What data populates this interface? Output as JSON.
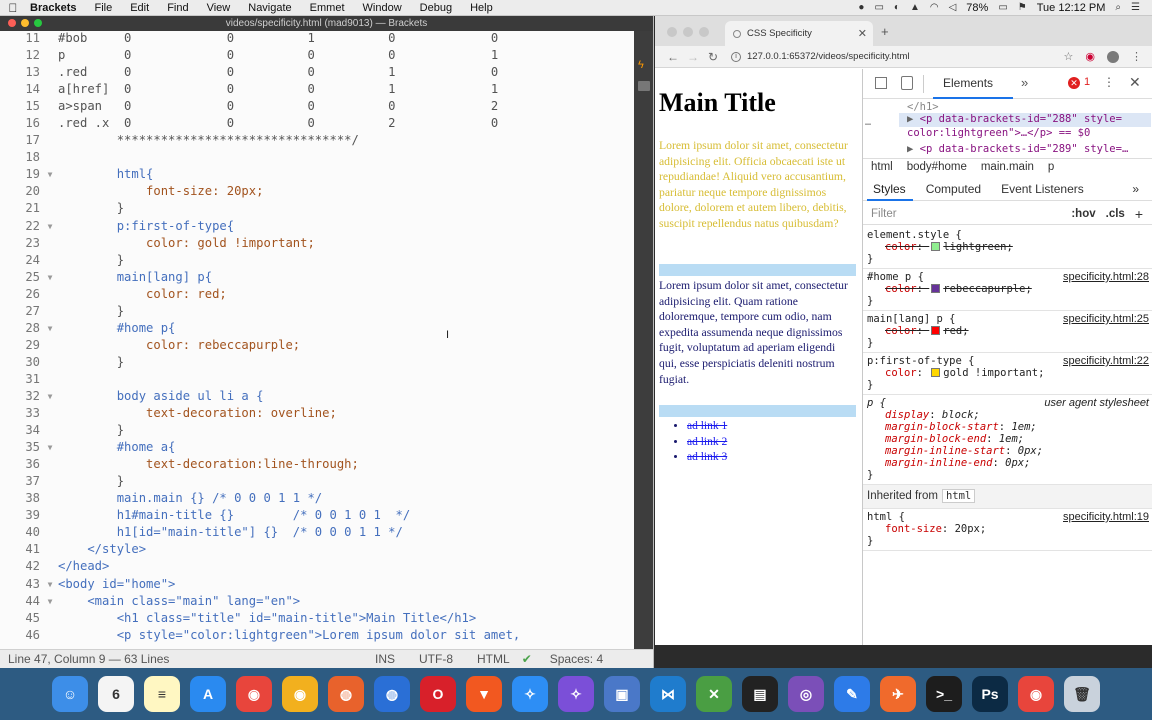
{
  "menubar": {
    "app": "Brackets",
    "items": [
      "File",
      "Edit",
      "Find",
      "View",
      "Navigate",
      "Emmet",
      "Window",
      "Debug",
      "Help"
    ],
    "battery": "78%",
    "clock": "Tue 12:12 PM"
  },
  "editor": {
    "title": "videos/specificity.html (mad9013) — Brackets",
    "lines": [
      {
        "n": "11",
        "text": "#bob     0             0          1          0             0",
        "cls": ""
      },
      {
        "n": "12",
        "text": "p        0             0          0          0             1",
        "cls": ""
      },
      {
        "n": "13",
        "text": ".red     0             0          0          1             0",
        "cls": ""
      },
      {
        "n": "14",
        "text": "a[href]  0             0          0          1             1",
        "cls": ""
      },
      {
        "n": "15",
        "text": "a>span   0             0          0          0             2",
        "cls": ""
      },
      {
        "n": "16",
        "text": ".red .x  0             0          0          2             0",
        "cls": ""
      },
      {
        "n": "17",
        "text": "        ********************************/",
        "cls": ""
      },
      {
        "n": "18",
        "text": "",
        "cls": ""
      },
      {
        "n": "19",
        "text": "        html{",
        "cls": "tag",
        "fold": "▼"
      },
      {
        "n": "20",
        "text": "            font-size: 20px;",
        "cls": "prop"
      },
      {
        "n": "21",
        "text": "        }",
        "cls": ""
      },
      {
        "n": "22",
        "text": "        p:first-of-type{",
        "cls": "tag",
        "fold": "▼"
      },
      {
        "n": "23",
        "text": "            color: gold !important;",
        "cls": "prop"
      },
      {
        "n": "24",
        "text": "        }",
        "cls": ""
      },
      {
        "n": "25",
        "text": "        main[lang] p{",
        "cls": "tag",
        "fold": "▼"
      },
      {
        "n": "26",
        "text": "            color: red;",
        "cls": "prop"
      },
      {
        "n": "27",
        "text": "        }",
        "cls": ""
      },
      {
        "n": "28",
        "text": "        #home p{",
        "cls": "tag",
        "fold": "▼"
      },
      {
        "n": "29",
        "text": "            color: rebeccapurple;",
        "cls": "prop"
      },
      {
        "n": "30",
        "text": "        }",
        "cls": ""
      },
      {
        "n": "31",
        "text": "",
        "cls": ""
      },
      {
        "n": "32",
        "text": "        body aside ul li a {",
        "cls": "tag",
        "fold": "▼"
      },
      {
        "n": "33",
        "text": "            text-decoration: overline;",
        "cls": "prop"
      },
      {
        "n": "34",
        "text": "        }",
        "cls": ""
      },
      {
        "n": "35",
        "text": "        #home a{",
        "cls": "tag",
        "fold": "▼"
      },
      {
        "n": "36",
        "text": "            text-decoration:line-through;",
        "cls": "prop"
      },
      {
        "n": "37",
        "text": "        }",
        "cls": ""
      },
      {
        "n": "38",
        "text": "        main.main {} /* 0 0 0 1 1 */",
        "cls": "tag"
      },
      {
        "n": "39",
        "text": "        h1#main-title {}        /* 0 0 1 0 1  */",
        "cls": "tag"
      },
      {
        "n": "40",
        "text": "        h1[id=\"main-title\"] {}  /* 0 0 0 1 1 */",
        "cls": "tag"
      },
      {
        "n": "41",
        "text": "    </style>",
        "cls": "tag"
      },
      {
        "n": "42",
        "text": "</head>",
        "cls": "tag"
      },
      {
        "n": "43",
        "text": "<body id=\"home\">",
        "cls": "tag",
        "fold": "▼"
      },
      {
        "n": "44",
        "text": "    <main class=\"main\" lang=\"en\">",
        "cls": "tag",
        "fold": "▼"
      },
      {
        "n": "45",
        "text": "        <h1 class=\"title\" id=\"main-title\">Main Title</h1>",
        "cls": "tag"
      },
      {
        "n": "46",
        "text": "        <p style=\"color:lightgreen\">Lorem ipsum dolor sit amet,",
        "cls": "tag"
      }
    ],
    "status": {
      "cursor": "Line 47, Column 9 — 63 Lines",
      "mode": "INS",
      "encoding": "UTF-8",
      "language": "HTML",
      "spaces": "Spaces: 4"
    }
  },
  "chrome": {
    "tab_title": "CSS Specificity",
    "url": "127.0.0.1:65372/videos/specificity.html",
    "page": {
      "title": "Main Title",
      "para1": "Lorem ipsum dolor sit amet, consectetur adipisicing elit. Officia obcaecati iste ut repudiandae! Aliquid vero accusantium, pariatur neque tempore dignissimos dolore, dolorem et autem libero, debitis, suscipit repellendus natus quibusdam?",
      "para2": "Lorem ipsum dolor sit amet, consectetur adipisicing elit. Quam ratione doloremque, tempore cum odio, nam expedita assumenda neque dignissimos fugit, voluptatum ad aperiam eligendi qui, esse perspiciatis deleniti nostrum fugiat.",
      "links": [
        "ad link 1",
        "ad link 2",
        "ad link 3"
      ]
    },
    "devtools": {
      "elements_tab": "Elements",
      "error_count": "1",
      "dom": {
        "row1": "</h1>",
        "row2": "<p data-brackets-id=\"288\" style=",
        "row3": "color:lightgreen\">…</p> == $0",
        "row4": "<p data-brackets-id=\"289\" style=…"
      },
      "breadcrumb": [
        "html",
        "body#home",
        "main.main",
        "p"
      ],
      "style_tabs": [
        "Styles",
        "Computed",
        "Event Listeners"
      ],
      "filter_placeholder": "Filter",
      "hov": ":hov",
      "cls": ".cls",
      "rules": [
        {
          "selector": "element.style {",
          "source": "",
          "decls": [
            {
              "name": "color",
              "value": "lightgreen;",
              "swatch": "#90ee90",
              "struck": true
            }
          ]
        },
        {
          "selector": "#home p {",
          "source": "specificity.html:28",
          "decls": [
            {
              "name": "color",
              "value": "rebeccapurple;",
              "swatch": "#663399",
              "struck": true
            }
          ]
        },
        {
          "selector": "main[lang] p {",
          "source": "specificity.html:25",
          "decls": [
            {
              "name": "color",
              "value": "red;",
              "swatch": "#ff0000",
              "struck": true
            }
          ]
        },
        {
          "selector": "p:first-of-type {",
          "source": "specificity.html:22",
          "decls": [
            {
              "name": "color",
              "value": "gold !important;",
              "swatch": "#ffd700",
              "struck": false
            }
          ]
        },
        {
          "selector": "p {",
          "source": "user agent stylesheet",
          "ua": true,
          "decls": [
            {
              "name": "display",
              "value": "block;"
            },
            {
              "name": "margin-block-start",
              "value": "1em;"
            },
            {
              "name": "margin-block-end",
              "value": "1em;"
            },
            {
              "name": "margin-inline-start",
              "value": "0px;"
            },
            {
              "name": "margin-inline-end",
              "value": "0px;"
            }
          ]
        }
      ],
      "inherited_label": "Inherited from",
      "inherited_tag": "html",
      "inherited_rule": {
        "selector": "html {",
        "source": "specificity.html:19",
        "decl_name": "font-size",
        "decl_value": "20px;"
      }
    }
  },
  "dock": {
    "icons": [
      {
        "name": "finder-icon",
        "color": "#3d8ee8",
        "glyph": "☺"
      },
      {
        "name": "calendar-icon",
        "color": "#f4f4f4",
        "glyph": "6"
      },
      {
        "name": "notes-icon",
        "color": "#fff7c2",
        "glyph": "≡"
      },
      {
        "name": "app-store-icon",
        "color": "#2a8af0",
        "glyph": "A"
      },
      {
        "name": "chrome-icon",
        "color": "#e8453c",
        "glyph": "◉"
      },
      {
        "name": "chrome-canary-icon",
        "color": "#f2b01e",
        "glyph": "◉"
      },
      {
        "name": "firefox-icon",
        "color": "#e8622c",
        "glyph": "◍"
      },
      {
        "name": "firefox-dev-icon",
        "color": "#2a6fd6",
        "glyph": "◍"
      },
      {
        "name": "opera-icon",
        "color": "#d8202a",
        "glyph": "O"
      },
      {
        "name": "brave-icon",
        "color": "#f25820",
        "glyph": "▼"
      },
      {
        "name": "safari-icon",
        "color": "#2d8ef5",
        "glyph": "✧"
      },
      {
        "name": "safari-tp-icon",
        "color": "#7b4fd8",
        "glyph": "✧"
      },
      {
        "name": "photo-booth-icon",
        "color": "#4a78c8",
        "glyph": "▣"
      },
      {
        "name": "visual-studio-icon",
        "color": "#1f7ccd",
        "glyph": "⋈"
      },
      {
        "name": "xcode-icon",
        "color": "#4a9e43",
        "glyph": "✕"
      },
      {
        "name": "tableplus-icon",
        "color": "#222222",
        "glyph": "▤"
      },
      {
        "name": "github-desktop-icon",
        "color": "#7b4fb8",
        "glyph": "◎"
      },
      {
        "name": "xd-icon",
        "color": "#2d7be8",
        "glyph": "✎"
      },
      {
        "name": "postman-icon",
        "color": "#f06a2c",
        "glyph": "✈"
      },
      {
        "name": "terminal-icon",
        "color": "#1d1d1d",
        "glyph": ">_"
      },
      {
        "name": "photoshop-icon",
        "color": "#0c2a44",
        "glyph": "Ps"
      },
      {
        "name": "chrome-2-icon",
        "color": "#e8453c",
        "glyph": "◉"
      },
      {
        "name": "trash-icon",
        "color": "#c9d2dc",
        "glyph": "🗑"
      }
    ]
  }
}
